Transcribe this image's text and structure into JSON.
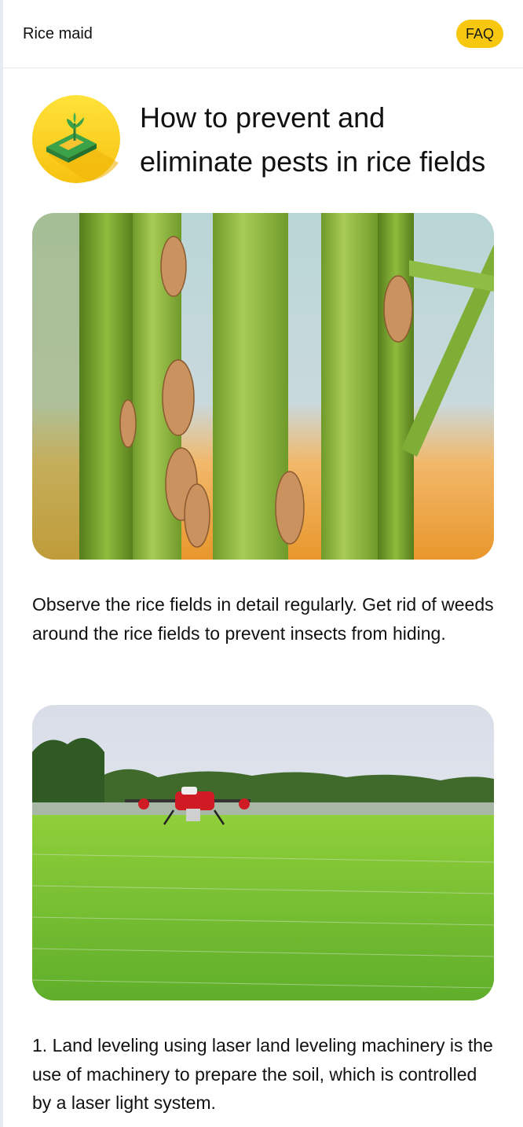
{
  "header": {
    "app_name": "Rice maid",
    "faq_label": "FAQ"
  },
  "article": {
    "title": "How to prevent and eliminate pests in rice fields",
    "paragraphs": [
      "Observe the rice fields in detail regularly. Get rid of weeds around the rice fields to prevent insects from hiding.",
      "1. Land leveling using laser land leveling machinery is the use of machinery to prepare the soil, which is controlled by a laser light system."
    ]
  },
  "icons": {
    "hero": "rice-field-sprout-icon"
  },
  "colors": {
    "accent": "#f7c80f",
    "text": "#111111",
    "divider": "#e5e7eb"
  }
}
